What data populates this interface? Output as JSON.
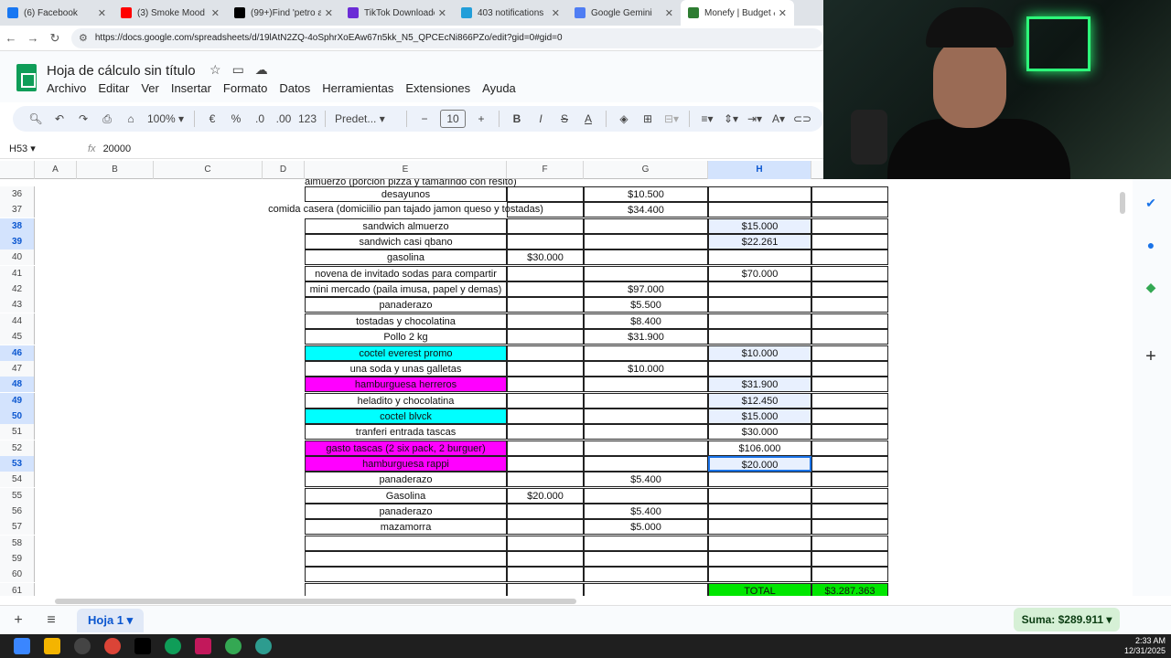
{
  "browser": {
    "tabs": [
      {
        "label": "(6) Facebook",
        "color": "#1877f2"
      },
      {
        "label": "(3) Smoke Mood",
        "color": "#ff0000"
      },
      {
        "label": "(99+)Find 'petro anu",
        "color": "#000000"
      },
      {
        "label": "TikTok Downloader -",
        "color": "#6b2cd6"
      },
      {
        "label": "403 notifications",
        "color": "#229ed9"
      },
      {
        "label": "Google Gemini",
        "color": "#4f7df3"
      },
      {
        "label": "Monefy | Budget & Tr",
        "color": "#2e7d32"
      }
    ],
    "url": "https://docs.google.com/spreadsheets/d/19lAtN2ZQ-4oSphrXoEAw67n5kk_N5_QPCEcNi866PZo/edit?gid=0#gid=0"
  },
  "doc": {
    "title": "Hoja de cálculo sin título",
    "menu": [
      "Archivo",
      "Editar",
      "Ver",
      "Insertar",
      "Formato",
      "Datos",
      "Herramientas",
      "Extensiones",
      "Ayuda"
    ]
  },
  "toolbar": {
    "zoom": "100%",
    "currency": "€",
    "percent": "%",
    "dec_minus": ".0",
    "dec_plus": ".00",
    "format_123": "123",
    "font": "Predet...",
    "font_size": "10"
  },
  "formula": {
    "cell_ref": "H53",
    "fx": "fx",
    "value": "20000"
  },
  "columns": [
    "A",
    "B",
    "C",
    "D",
    "E",
    "F",
    "G",
    "H"
  ],
  "partial_row": "almuerzo (porcion pizza y tamarindo con resito)",
  "rows": [
    {
      "n": "36",
      "e": "desayunos",
      "f": "",
      "g": "$10.500",
      "h": "",
      "ecolor": "",
      "sel": false,
      "hhl": false
    },
    {
      "n": "37",
      "e": "comida casera (domiciilio pan tajado jamon queso y tostadas)",
      "f": "",
      "g": "$34.400",
      "h": "",
      "ecolor": "",
      "sel": false,
      "hhl": false,
      "noborder": true
    },
    {
      "n": "38",
      "e": "sandwich almuerzo",
      "f": "",
      "g": "",
      "h": "$15.000",
      "ecolor": "",
      "sel": true,
      "hhl": true
    },
    {
      "n": "39",
      "e": "sandwich casi qbano",
      "f": "",
      "g": "",
      "h": "$22.261",
      "ecolor": "",
      "sel": true,
      "hhl": true
    },
    {
      "n": "40",
      "e": "gasolina",
      "f": "$30.000",
      "g": "",
      "h": "",
      "ecolor": "",
      "sel": false,
      "hhl": false
    },
    {
      "n": "41",
      "e": "novena de invitado sodas para compartir",
      "f": "",
      "g": "",
      "h": "$70.000",
      "ecolor": "",
      "sel": false,
      "hhl": false
    },
    {
      "n": "42",
      "e": "mini mercado (paila imusa, papel y demas)",
      "f": "",
      "g": "$97.000",
      "h": "",
      "ecolor": "",
      "sel": false,
      "hhl": false
    },
    {
      "n": "43",
      "e": "panaderazo",
      "f": "",
      "g": "$5.500",
      "h": "",
      "ecolor": "",
      "sel": false,
      "hhl": false
    },
    {
      "n": "44",
      "e": "tostadas y chocolatina",
      "f": "",
      "g": "$8.400",
      "h": "",
      "ecolor": "",
      "sel": false,
      "hhl": false
    },
    {
      "n": "45",
      "e": "Pollo 2 kg",
      "f": "",
      "g": "$31.900",
      "h": "",
      "ecolor": "",
      "sel": false,
      "hhl": false
    },
    {
      "n": "46",
      "e": "coctel everest promo",
      "f": "",
      "g": "",
      "h": "$10.000",
      "ecolor": "#00ffff",
      "sel": true,
      "hhl": true
    },
    {
      "n": "47",
      "e": "una soda y unas galletas",
      "f": "",
      "g": "$10.000",
      "h": "",
      "ecolor": "",
      "sel": false,
      "hhl": false
    },
    {
      "n": "48",
      "e": "hamburguesa herreros",
      "f": "",
      "g": "",
      "h": "$31.900",
      "ecolor": "#ff00ff",
      "sel": true,
      "hhl": true
    },
    {
      "n": "49",
      "e": "heladito y chocolatina",
      "f": "",
      "g": "",
      "h": "$12.450",
      "ecolor": "",
      "sel": true,
      "hhl": true
    },
    {
      "n": "50",
      "e": "coctel blvck",
      "f": "",
      "g": "",
      "h": "$15.000",
      "ecolor": "#00ffff",
      "sel": true,
      "hhl": true
    },
    {
      "n": "51",
      "e": "tranferi entrada tascas",
      "f": "",
      "g": "",
      "h": "$30.000",
      "ecolor": "",
      "sel": false,
      "hhl": false
    },
    {
      "n": "52",
      "e": "gasto tascas (2 six pack, 2 burguer)",
      "f": "",
      "g": "",
      "h": "$106.000",
      "ecolor": "#ff00ff",
      "sel": false,
      "hhl": false
    },
    {
      "n": "53",
      "e": "hamburguesa rappi",
      "f": "",
      "g": "",
      "h": "$20.000",
      "ecolor": "#ff00ff",
      "sel": true,
      "hhl": true,
      "active": true
    },
    {
      "n": "54",
      "e": "panaderazo",
      "f": "",
      "g": "$5.400",
      "h": "",
      "ecolor": "",
      "sel": false,
      "hhl": false
    },
    {
      "n": "55",
      "e": "Gasolina",
      "f": "$20.000",
      "g": "",
      "h": "",
      "ecolor": "",
      "sel": false,
      "hhl": false
    },
    {
      "n": "56",
      "e": "panaderazo",
      "f": "",
      "g": "$5.400",
      "h": "",
      "ecolor": "",
      "sel": false,
      "hhl": false
    },
    {
      "n": "57",
      "e": "mazamorra",
      "f": "",
      "g": "$5.000",
      "h": "",
      "ecolor": "",
      "sel": false,
      "hhl": false
    },
    {
      "n": "58",
      "e": "",
      "f": "",
      "g": "",
      "h": "",
      "ecolor": "",
      "sel": false,
      "hhl": false
    },
    {
      "n": "59",
      "e": "",
      "f": "",
      "g": "",
      "h": "",
      "ecolor": "",
      "sel": false,
      "hhl": false
    },
    {
      "n": "60",
      "e": "",
      "f": "",
      "g": "",
      "h": "",
      "ecolor": "",
      "sel": false,
      "hhl": false
    },
    {
      "n": "61",
      "e": "",
      "f": "",
      "g": "",
      "h": "TOTAL",
      "i": "$3.287.363",
      "ecolor": "",
      "sel": false,
      "hhl": false,
      "total": true
    }
  ],
  "total_color": "#00e600",
  "sheet": {
    "tab": "Hoja 1",
    "sum": "Suma: $289.911"
  },
  "clock": {
    "time": "2:33 AM",
    "date": "12/31/2025"
  }
}
